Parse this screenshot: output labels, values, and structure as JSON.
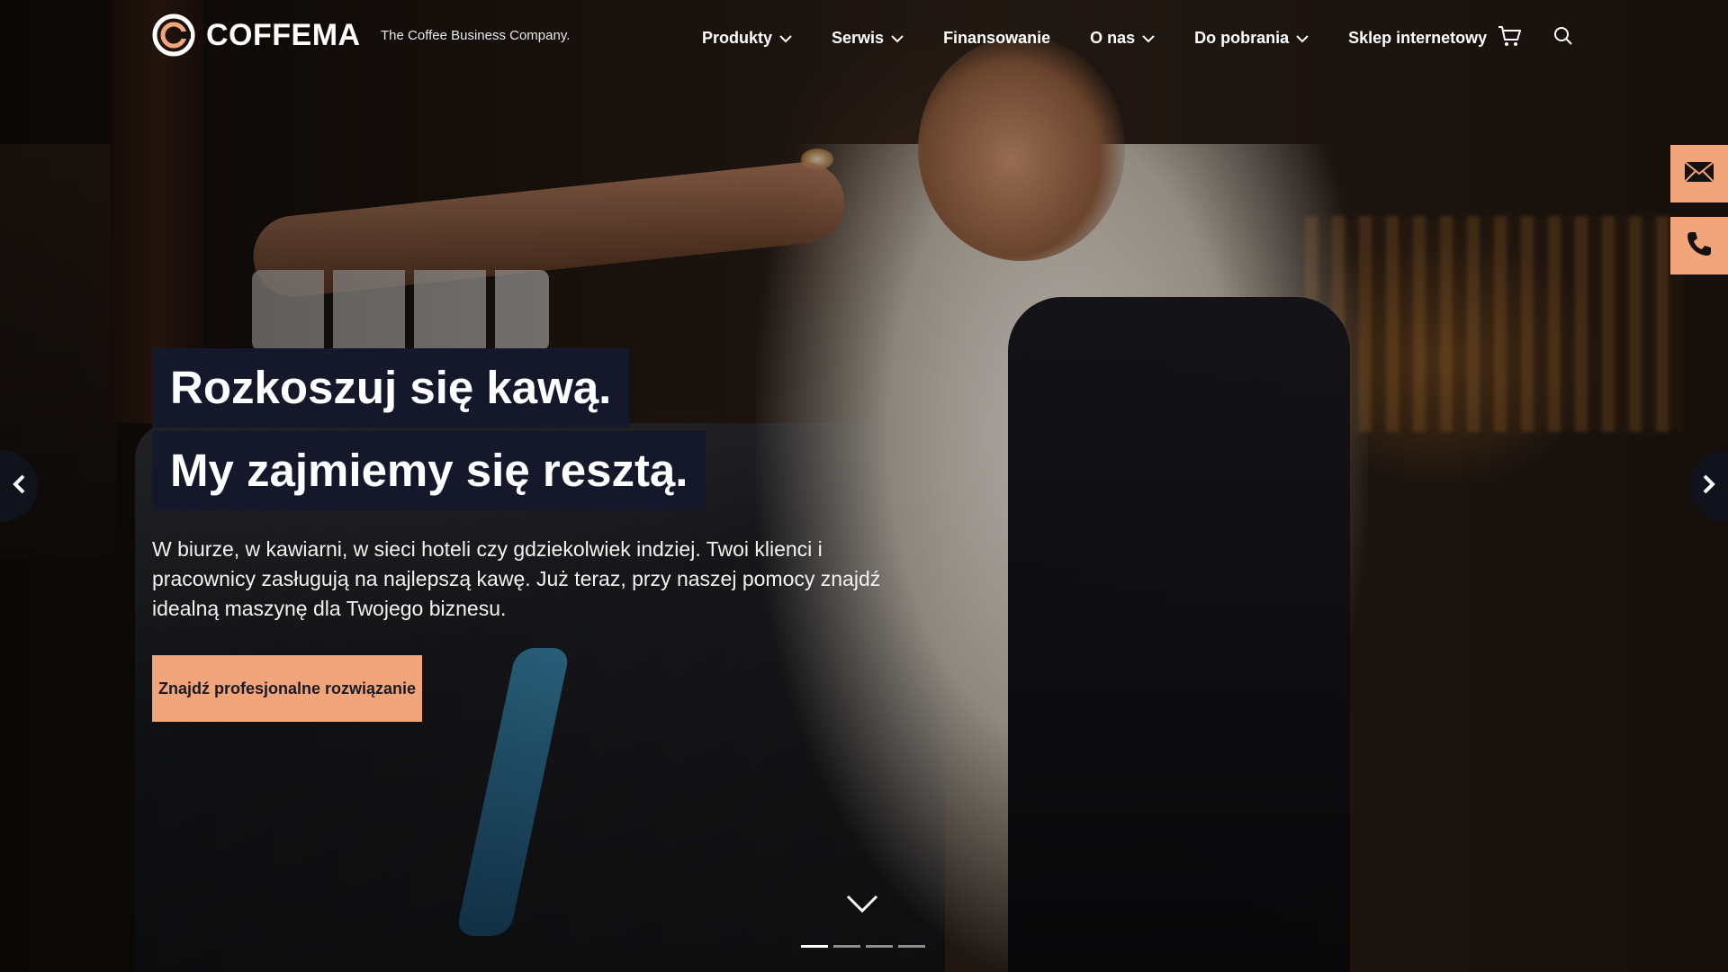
{
  "brand": {
    "name": "COFFEMA",
    "tagline": "The Coffee Business Company.",
    "accent_color": "#f2a57a",
    "headline_bg": "#15182b"
  },
  "nav": {
    "items": [
      {
        "label": "Produkty",
        "has_dropdown": true
      },
      {
        "label": "Serwis",
        "has_dropdown": true
      },
      {
        "label": "Finansowanie",
        "has_dropdown": false
      },
      {
        "label": "O nas",
        "has_dropdown": true
      },
      {
        "label": "Do pobrania",
        "has_dropdown": true
      },
      {
        "label": "Sklep internetowy",
        "has_dropdown": false
      }
    ],
    "cart_icon": "cart-icon",
    "search_icon": "search-icon"
  },
  "side_contact": {
    "email_icon": "envelope-icon",
    "phone_icon": "phone-icon"
  },
  "hero": {
    "headline_line1": "Rozkoszuj się kawą.",
    "headline_line2": "My zajmiemy się resztą.",
    "description": "W biurze, w kawiarni, w sieci hoteli czy gdziekolwiek indziej. Twoi klienci i pracownicy zasługują na najlepszą kawę. Już teraz, przy naszej pomocy znajdź idealną maszynę dla Twojego biznesu.",
    "cta_label": "Znajdź profesjonalne rozwiązanie",
    "slide_count": 4,
    "active_slide": 1
  }
}
